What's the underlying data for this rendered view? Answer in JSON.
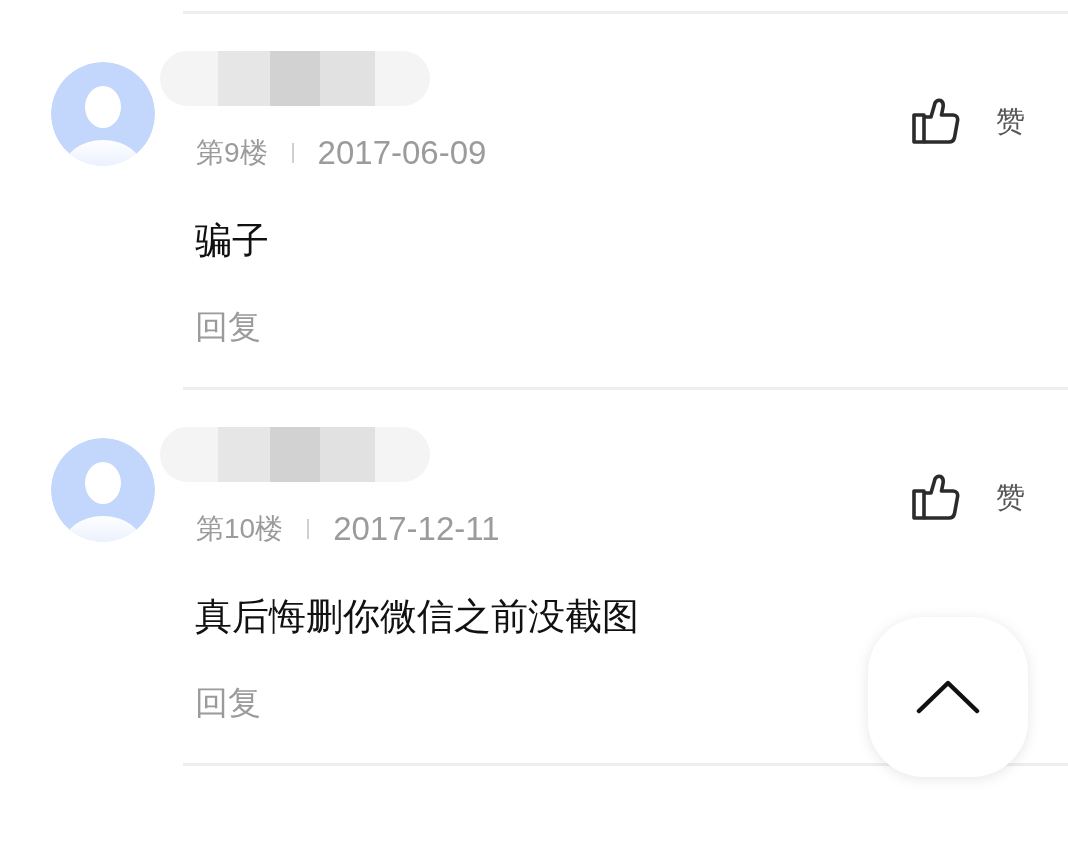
{
  "comments": [
    {
      "floor": "第9楼",
      "date": "2017-06-09",
      "body": "骗子",
      "reply": "回复",
      "like": "赞"
    },
    {
      "floor": "第10楼",
      "date": "2017-12-11",
      "body": "真后悔删你微信之前没截图",
      "reply": "回复",
      "like": "赞"
    }
  ]
}
